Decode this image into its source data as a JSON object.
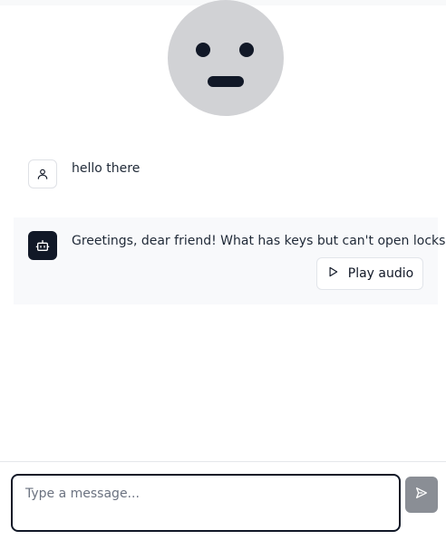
{
  "messages": [
    {
      "role": "user",
      "icon": "user-icon",
      "text": "hello there"
    },
    {
      "role": "assistant",
      "icon": "bot-icon",
      "text": "Greetings, dear friend! What has keys but can't open locks?"
    }
  ],
  "play_audio": {
    "label": "Play audio",
    "icon": "play-icon"
  },
  "composer": {
    "placeholder": "Type a message...",
    "send_icon": "send-icon"
  },
  "colors": {
    "dark": "#111827",
    "face": "#d1d2d5",
    "send_disabled": "#8a8e95"
  }
}
